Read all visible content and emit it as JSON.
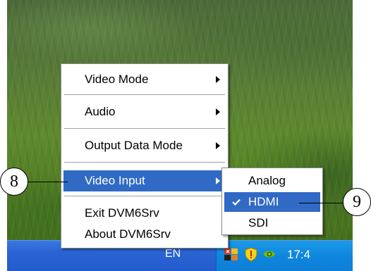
{
  "taskbar": {
    "language": "EN",
    "clock": "17:4"
  },
  "main_menu": {
    "items": [
      {
        "label": "Video Mode",
        "has_submenu": true,
        "selected": false
      },
      {
        "label": "Audio",
        "has_submenu": true,
        "selected": false
      },
      {
        "label": "Output Data Mode",
        "has_submenu": true,
        "selected": false
      },
      {
        "label": "Video Input",
        "has_submenu": true,
        "selected": true
      },
      {
        "label": "Exit DVM6Srv",
        "has_submenu": false,
        "selected": false
      },
      {
        "label": "About DVM6Srv",
        "has_submenu": false,
        "selected": false
      }
    ]
  },
  "submenu": {
    "items": [
      {
        "label": "Analog",
        "checked": false,
        "selected": false
      },
      {
        "label": "HDMI",
        "checked": true,
        "selected": true
      },
      {
        "label": "SDI",
        "checked": false,
        "selected": false
      }
    ]
  },
  "callouts": {
    "first": "8",
    "second": "9"
  },
  "colors": {
    "highlight": "#316ac5",
    "taskbar": "#2a63d4",
    "tray": "#0f86de"
  },
  "icons": {
    "tray": [
      "app-icon",
      "security-shield-icon",
      "nvidia-icon"
    ],
    "submenu_arrow": "chevron-right-icon",
    "check": "checkmark-icon"
  }
}
